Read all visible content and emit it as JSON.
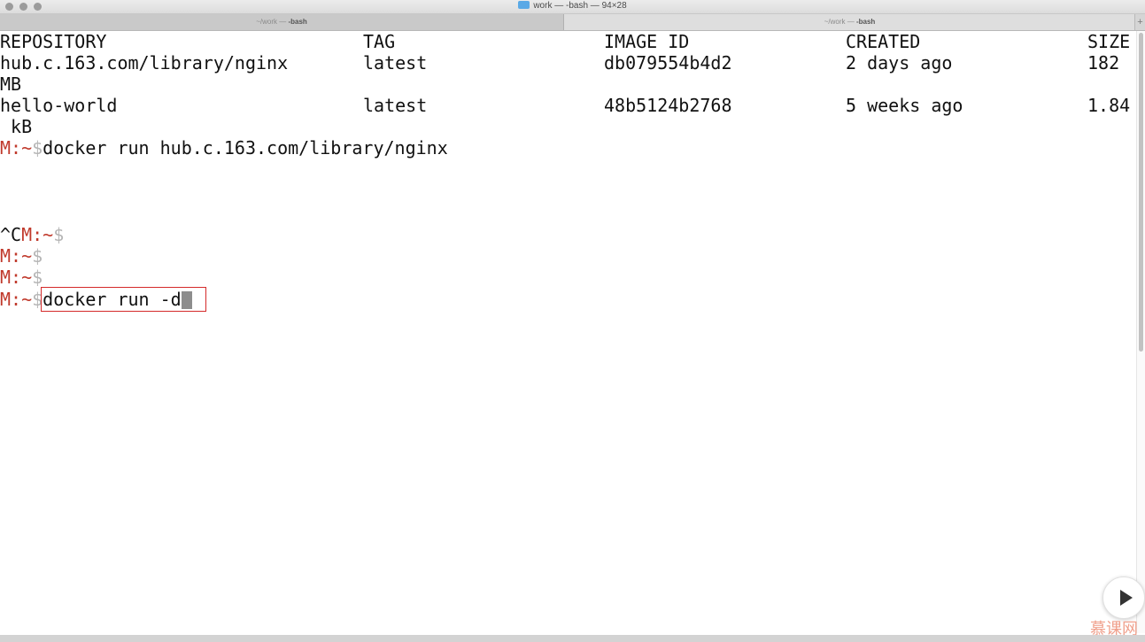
{
  "window": {
    "title": "work — -bash — 94×28",
    "tabs": [
      {
        "path": "~/work — ",
        "name": "-bash"
      },
      {
        "path": "~/work — ",
        "name": "-bash"
      }
    ],
    "add_tab": "+"
  },
  "terminal": {
    "header": {
      "repository": "REPOSITORY",
      "tag": "TAG",
      "image_id": "IMAGE ID",
      "created": "CREATED",
      "size": "SIZE"
    },
    "rows": [
      {
        "repository": "hub.c.163.com/library/nginx",
        "tag": "latest",
        "image_id": "db079554b4d2",
        "created": "2 days ago",
        "size": "182",
        "size_wrap": "MB"
      },
      {
        "repository": "hello-world",
        "tag": "latest",
        "image_id": "48b5124b2768",
        "created": "5 weeks ago",
        "size": "1.84",
        "size_wrap": " kB"
      }
    ],
    "prompt_m": "M:~",
    "prompt_dollar": "$",
    "cmd1": "docker run hub.c.163.com/library/nginx",
    "ctrl_c": "^C",
    "current_cmd": "docker run -d"
  },
  "watermark": "慕课网",
  "colors": {
    "prompt": "#c0392b",
    "highlight_box": "#d42a2a",
    "cursor": "#8d8d8d"
  }
}
